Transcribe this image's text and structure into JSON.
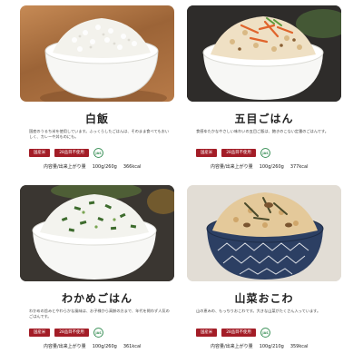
{
  "items": [
    {
      "name": "白飯",
      "desc": "国産のうるち米を使用しています。ふっくらしたごはんは、そのまま食べてもおいしく、カレーや丼ものにも。",
      "badges": [
        "国産米",
        "28品目不使用"
      ],
      "jas_label": "JAS",
      "spec_label": "内容量/出来上がり量",
      "spec_amount": "100g/260g",
      "spec_kcal": "366kcal"
    },
    {
      "name": "五目ごはん",
      "desc": "食感ゆたかなやさしい味わいの五目ご飯は、飽きのこない定番のごはんです。",
      "badges": [
        "国産米",
        "28品目不使用"
      ],
      "jas_label": "JAS",
      "spec_label": "内容量/出来上がり量",
      "spec_amount": "100g/260g",
      "spec_kcal": "377kcal"
    },
    {
      "name": "わかめごはん",
      "desc": "わかめの旨みとやわらかな風味は、お子様から高齢の方まで、年代を問わず人気のごはんです。",
      "badges": [
        "国産米",
        "28品目不使用"
      ],
      "jas_label": "JAS",
      "spec_label": "内容量/出来上がり量",
      "spec_amount": "100g/260g",
      "spec_kcal": "361kcal"
    },
    {
      "name": "山菜おこわ",
      "desc": "山の恵みの、もっちりおこわです。大きな山菜がたくさん入っています。",
      "badges": [
        "国産米",
        "28品目不使用"
      ],
      "jas_label": "JAS",
      "spec_label": "内容量/出来上がり量",
      "spec_amount": "100g/210g",
      "spec_kcal": "359kcal"
    }
  ],
  "colors": {
    "badge": "#a31d27",
    "jas": "#2f8a4e"
  }
}
